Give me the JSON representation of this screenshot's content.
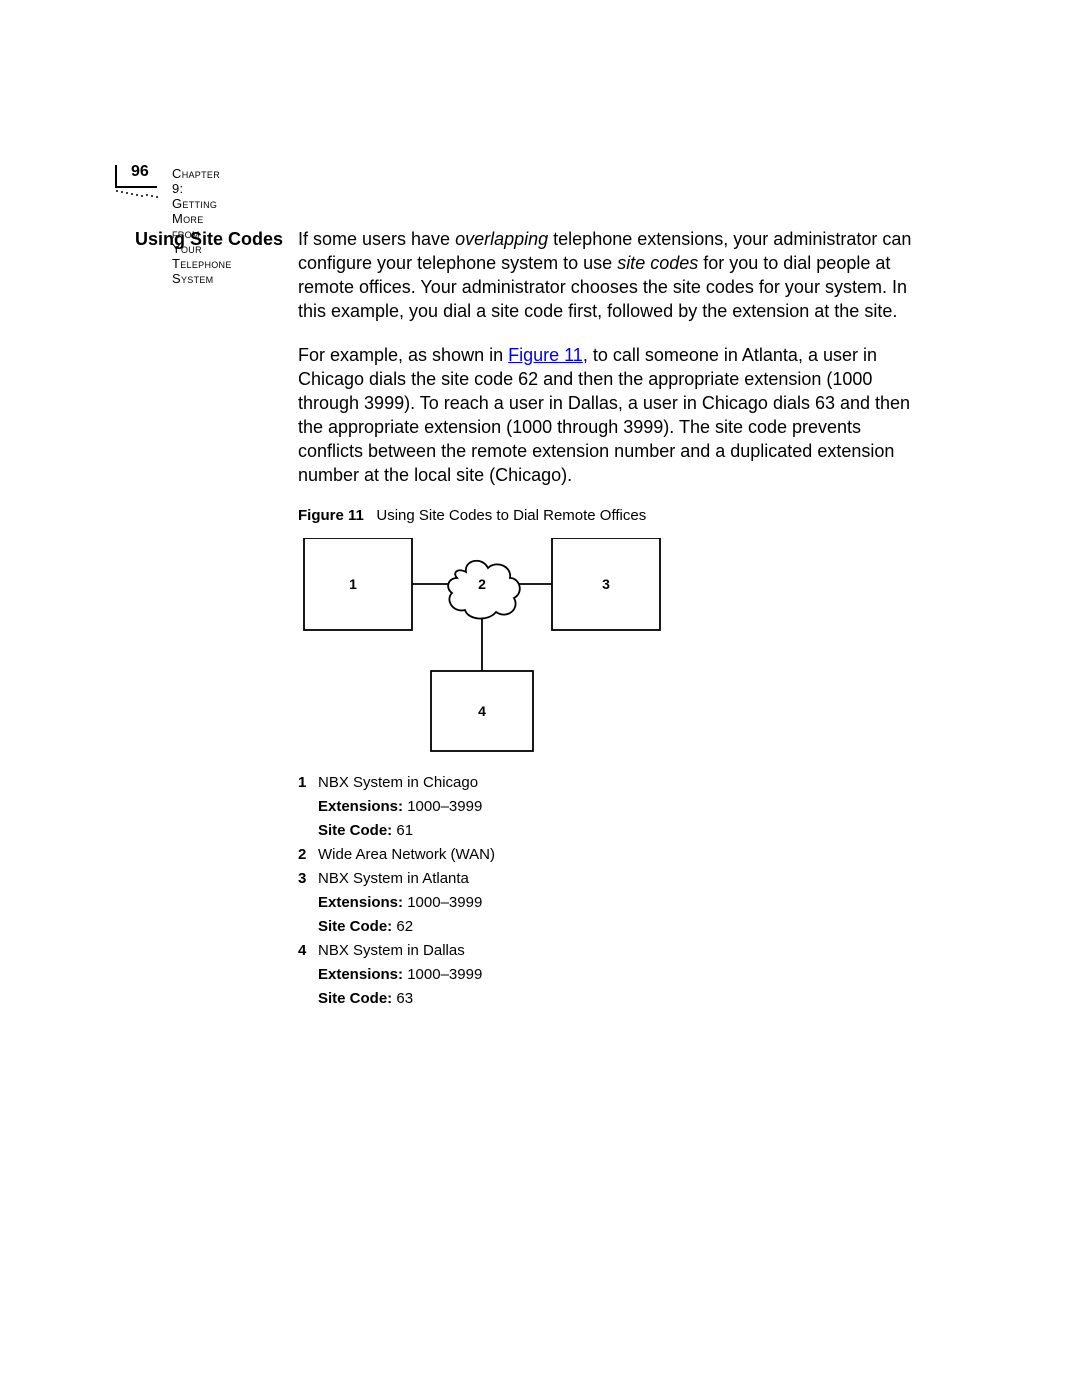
{
  "header": {
    "page_number": "96",
    "chapter": "Chapter 9: Getting More from Your Telephone System"
  },
  "side_heading": "Using Site Codes",
  "para1": {
    "pre": "If some users have ",
    "em1": "overlapping",
    "mid": " telephone extensions, your administrator can configure your telephone system to use ",
    "em2": "site codes",
    "post": " for you to dial people at remote offices. Your administrator chooses the site codes for your system. In this example, you dial a site code first, followed by the extension at the site."
  },
  "para2": {
    "pre": "For example, as shown in ",
    "link": "Figure 11",
    "post": ", to call someone in Atlanta, a user in Chicago dials the site code 62 and then the appropriate extension (1000 through 3999). To reach a user in Dallas, a user in Chicago dials 63 and then the appropriate extension (1000 through 3999). The site code prevents conflicts between the remote extension number and a duplicated extension number at the local site (Chicago)."
  },
  "figure": {
    "label": "Figure 11",
    "caption": "Using Site Codes to Dial Remote Offices",
    "nodes": {
      "n1": "1",
      "n2": "2",
      "n3": "3",
      "n4": "4"
    }
  },
  "legend": [
    {
      "num": "1",
      "title": "NBX System in Chicago",
      "ext_label": "Extensions:",
      "ext_val": "1000–3999",
      "sc_label": "Site Code:",
      "sc_val": "61"
    },
    {
      "num": "2",
      "title": "Wide Area Network (WAN)"
    },
    {
      "num": "3",
      "title": "NBX System in Atlanta",
      "ext_label": "Extensions:",
      "ext_val": "1000–3999",
      "sc_label": "Site Code:",
      "sc_val": "62"
    },
    {
      "num": "4",
      "title": "NBX System in Dallas",
      "ext_label": "Extensions:",
      "ext_val": "1000–3999",
      "sc_label": "Site Code:",
      "sc_val": "63"
    }
  ]
}
